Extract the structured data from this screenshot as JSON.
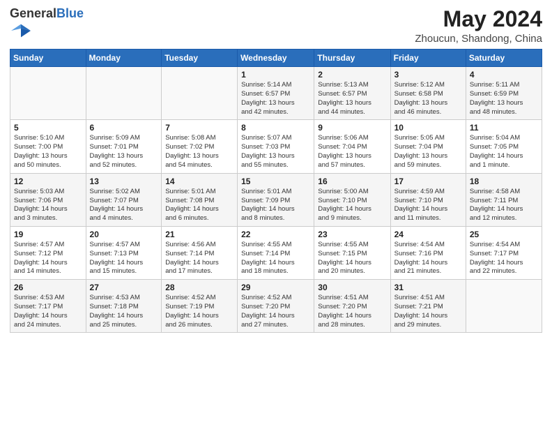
{
  "header": {
    "logo_general": "General",
    "logo_blue": "Blue",
    "title": "May 2024",
    "location": "Zhoucun, Shandong, China"
  },
  "weekdays": [
    "Sunday",
    "Monday",
    "Tuesday",
    "Wednesday",
    "Thursday",
    "Friday",
    "Saturday"
  ],
  "weeks": [
    [
      {
        "day": "",
        "info": ""
      },
      {
        "day": "",
        "info": ""
      },
      {
        "day": "",
        "info": ""
      },
      {
        "day": "1",
        "info": "Sunrise: 5:14 AM\nSunset: 6:57 PM\nDaylight: 13 hours\nand 42 minutes."
      },
      {
        "day": "2",
        "info": "Sunrise: 5:13 AM\nSunset: 6:57 PM\nDaylight: 13 hours\nand 44 minutes."
      },
      {
        "day": "3",
        "info": "Sunrise: 5:12 AM\nSunset: 6:58 PM\nDaylight: 13 hours\nand 46 minutes."
      },
      {
        "day": "4",
        "info": "Sunrise: 5:11 AM\nSunset: 6:59 PM\nDaylight: 13 hours\nand 48 minutes."
      }
    ],
    [
      {
        "day": "5",
        "info": "Sunrise: 5:10 AM\nSunset: 7:00 PM\nDaylight: 13 hours\nand 50 minutes."
      },
      {
        "day": "6",
        "info": "Sunrise: 5:09 AM\nSunset: 7:01 PM\nDaylight: 13 hours\nand 52 minutes."
      },
      {
        "day": "7",
        "info": "Sunrise: 5:08 AM\nSunset: 7:02 PM\nDaylight: 13 hours\nand 54 minutes."
      },
      {
        "day": "8",
        "info": "Sunrise: 5:07 AM\nSunset: 7:03 PM\nDaylight: 13 hours\nand 55 minutes."
      },
      {
        "day": "9",
        "info": "Sunrise: 5:06 AM\nSunset: 7:04 PM\nDaylight: 13 hours\nand 57 minutes."
      },
      {
        "day": "10",
        "info": "Sunrise: 5:05 AM\nSunset: 7:04 PM\nDaylight: 13 hours\nand 59 minutes."
      },
      {
        "day": "11",
        "info": "Sunrise: 5:04 AM\nSunset: 7:05 PM\nDaylight: 14 hours\nand 1 minute."
      }
    ],
    [
      {
        "day": "12",
        "info": "Sunrise: 5:03 AM\nSunset: 7:06 PM\nDaylight: 14 hours\nand 3 minutes."
      },
      {
        "day": "13",
        "info": "Sunrise: 5:02 AM\nSunset: 7:07 PM\nDaylight: 14 hours\nand 4 minutes."
      },
      {
        "day": "14",
        "info": "Sunrise: 5:01 AM\nSunset: 7:08 PM\nDaylight: 14 hours\nand 6 minutes."
      },
      {
        "day": "15",
        "info": "Sunrise: 5:01 AM\nSunset: 7:09 PM\nDaylight: 14 hours\nand 8 minutes."
      },
      {
        "day": "16",
        "info": "Sunrise: 5:00 AM\nSunset: 7:10 PM\nDaylight: 14 hours\nand 9 minutes."
      },
      {
        "day": "17",
        "info": "Sunrise: 4:59 AM\nSunset: 7:10 PM\nDaylight: 14 hours\nand 11 minutes."
      },
      {
        "day": "18",
        "info": "Sunrise: 4:58 AM\nSunset: 7:11 PM\nDaylight: 14 hours\nand 12 minutes."
      }
    ],
    [
      {
        "day": "19",
        "info": "Sunrise: 4:57 AM\nSunset: 7:12 PM\nDaylight: 14 hours\nand 14 minutes."
      },
      {
        "day": "20",
        "info": "Sunrise: 4:57 AM\nSunset: 7:13 PM\nDaylight: 14 hours\nand 15 minutes."
      },
      {
        "day": "21",
        "info": "Sunrise: 4:56 AM\nSunset: 7:14 PM\nDaylight: 14 hours\nand 17 minutes."
      },
      {
        "day": "22",
        "info": "Sunrise: 4:55 AM\nSunset: 7:14 PM\nDaylight: 14 hours\nand 18 minutes."
      },
      {
        "day": "23",
        "info": "Sunrise: 4:55 AM\nSunset: 7:15 PM\nDaylight: 14 hours\nand 20 minutes."
      },
      {
        "day": "24",
        "info": "Sunrise: 4:54 AM\nSunset: 7:16 PM\nDaylight: 14 hours\nand 21 minutes."
      },
      {
        "day": "25",
        "info": "Sunrise: 4:54 AM\nSunset: 7:17 PM\nDaylight: 14 hours\nand 22 minutes."
      }
    ],
    [
      {
        "day": "26",
        "info": "Sunrise: 4:53 AM\nSunset: 7:17 PM\nDaylight: 14 hours\nand 24 minutes."
      },
      {
        "day": "27",
        "info": "Sunrise: 4:53 AM\nSunset: 7:18 PM\nDaylight: 14 hours\nand 25 minutes."
      },
      {
        "day": "28",
        "info": "Sunrise: 4:52 AM\nSunset: 7:19 PM\nDaylight: 14 hours\nand 26 minutes."
      },
      {
        "day": "29",
        "info": "Sunrise: 4:52 AM\nSunset: 7:20 PM\nDaylight: 14 hours\nand 27 minutes."
      },
      {
        "day": "30",
        "info": "Sunrise: 4:51 AM\nSunset: 7:20 PM\nDaylight: 14 hours\nand 28 minutes."
      },
      {
        "day": "31",
        "info": "Sunrise: 4:51 AM\nSunset: 7:21 PM\nDaylight: 14 hours\nand 29 minutes."
      },
      {
        "day": "",
        "info": ""
      }
    ]
  ]
}
